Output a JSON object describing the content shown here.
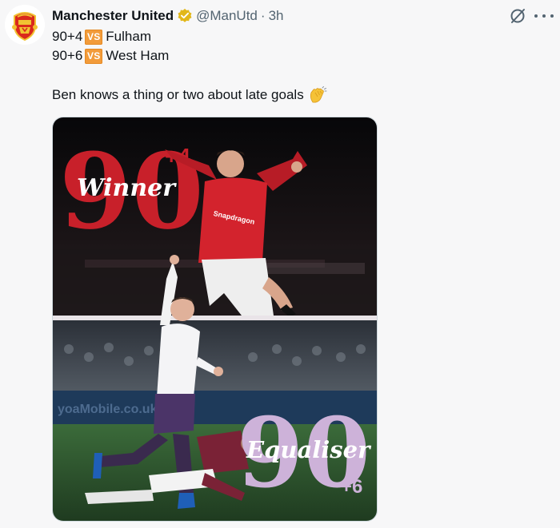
{
  "tweet": {
    "author_name": "Manchester United",
    "handle": "@ManUtd",
    "separator": "·",
    "time": "3h",
    "lines": [
      {
        "score": "90+4",
        "vs": "VS",
        "opponent": "Fulham"
      },
      {
        "score": "90+6",
        "vs": "VS",
        "opponent": "West Ham"
      }
    ],
    "body_text": "Ben knows a thing or two about late goals",
    "icons": {
      "verified": "verified-badge-icon",
      "grok": "slash-circle-icon",
      "more": "more-options-icon",
      "clap": "clapping-hands-icon"
    },
    "colors": {
      "vs_badge": "#f29b3a",
      "verified_badge": "#e2b719",
      "winner_red": "#c8202a",
      "equaliser_lilac": "#cdb2d9"
    }
  },
  "media": {
    "top_graphic": {
      "big_number": "90",
      "added": "+4",
      "word": "Winner"
    },
    "bottom_graphic": {
      "big_number": "90",
      "added": "+6",
      "word": "Equaliser"
    }
  }
}
